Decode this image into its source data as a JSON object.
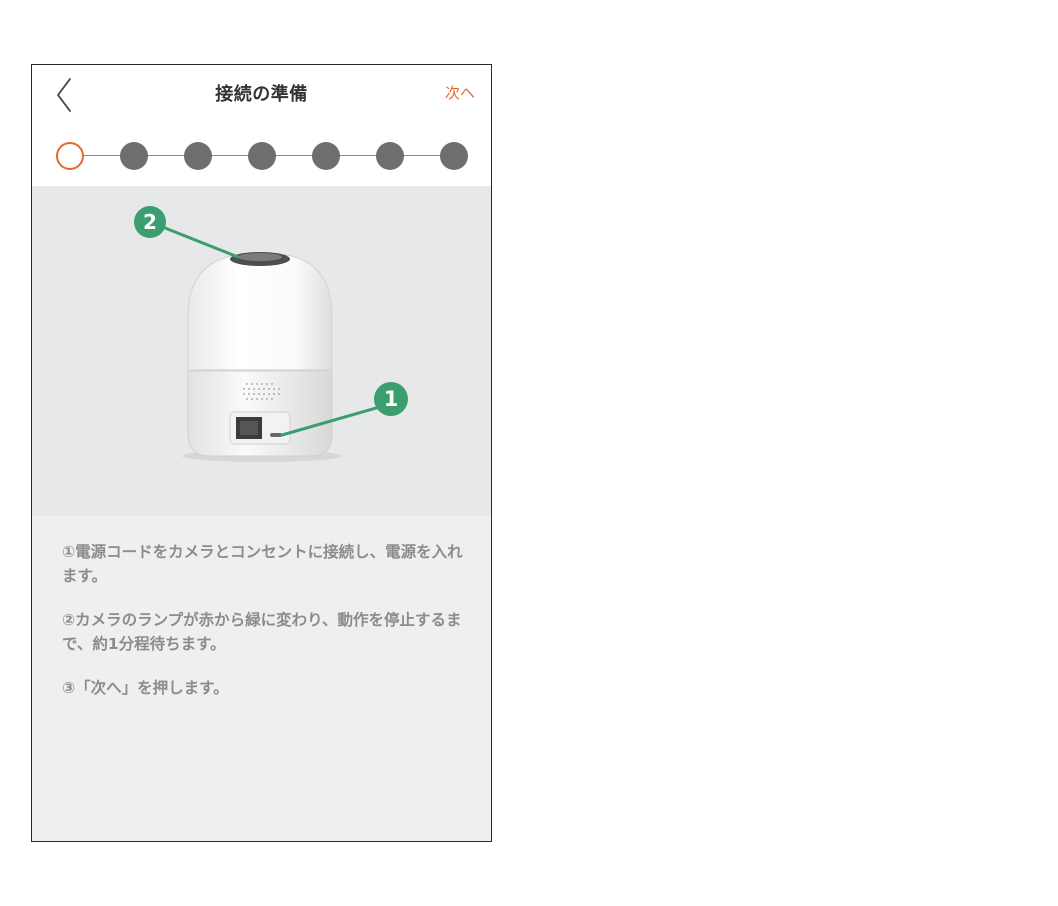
{
  "header": {
    "title": "接続の準備",
    "next_label": "次へ",
    "back_icon": "chevron-left-icon"
  },
  "stepper": {
    "total_steps": 7,
    "current_step": 1
  },
  "illustration": {
    "markers": [
      "1",
      "2"
    ]
  },
  "instructions": [
    "①電源コードをカメラとコンセントに接続し、電源を入れます。",
    "②カメラのランプが赤から緑に変わり、動作を停止するまで、約1分程待ちます。",
    "③「次へ」を押します。"
  ],
  "colors": {
    "accent": "#e4692d",
    "marker_green": "#3b9e6e",
    "step_inactive": "#6e6e6e",
    "text_secondary": "#8c8c8c"
  }
}
